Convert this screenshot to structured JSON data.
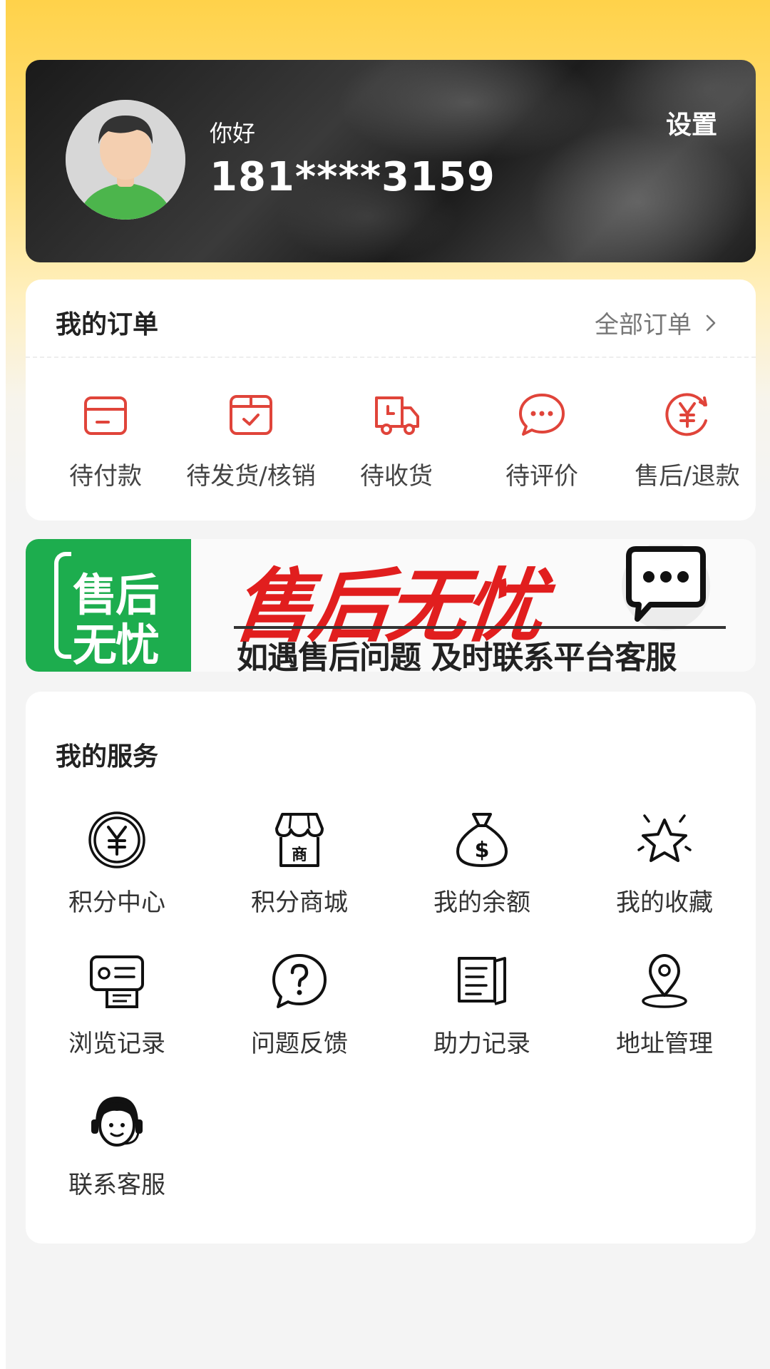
{
  "profile": {
    "greeting": "你好",
    "phone": "181****3159",
    "settings_label": "设置"
  },
  "orders": {
    "title": "我的订单",
    "all_label": "全部订单",
    "items": [
      {
        "label": "待付款",
        "icon": "wallet-icon"
      },
      {
        "label": "待发货/核销",
        "icon": "calendar-check-icon"
      },
      {
        "label": "待收货",
        "icon": "truck-icon"
      },
      {
        "label": "待评价",
        "icon": "chat-dots-icon"
      },
      {
        "label": "售后/退款",
        "icon": "yen-refund-icon"
      }
    ]
  },
  "banner": {
    "badge_line1": "售后",
    "badge_line2": "无忧",
    "headline": "售后无忧",
    "subline": "如遇售后问题 及时联系平台客服"
  },
  "services": {
    "title": "我的服务",
    "items": [
      {
        "label": "积分中心",
        "icon": "yen-coin-icon"
      },
      {
        "label": "积分商城",
        "icon": "shop-icon"
      },
      {
        "label": "我的余额",
        "icon": "money-bag-icon"
      },
      {
        "label": "我的收藏",
        "icon": "star-icon"
      },
      {
        "label": "浏览记录",
        "icon": "id-card-icon"
      },
      {
        "label": "问题反馈",
        "icon": "question-bubble-icon"
      },
      {
        "label": "助力记录",
        "icon": "book-icon"
      },
      {
        "label": "地址管理",
        "icon": "location-pin-icon"
      },
      {
        "label": "联系客服",
        "icon": "headset-agent-icon"
      }
    ]
  },
  "colors": {
    "accent_red": "#e0443a",
    "banner_green": "#1dad4e",
    "banner_red": "#e11e1e",
    "header_yellow": "#ffd24a"
  }
}
